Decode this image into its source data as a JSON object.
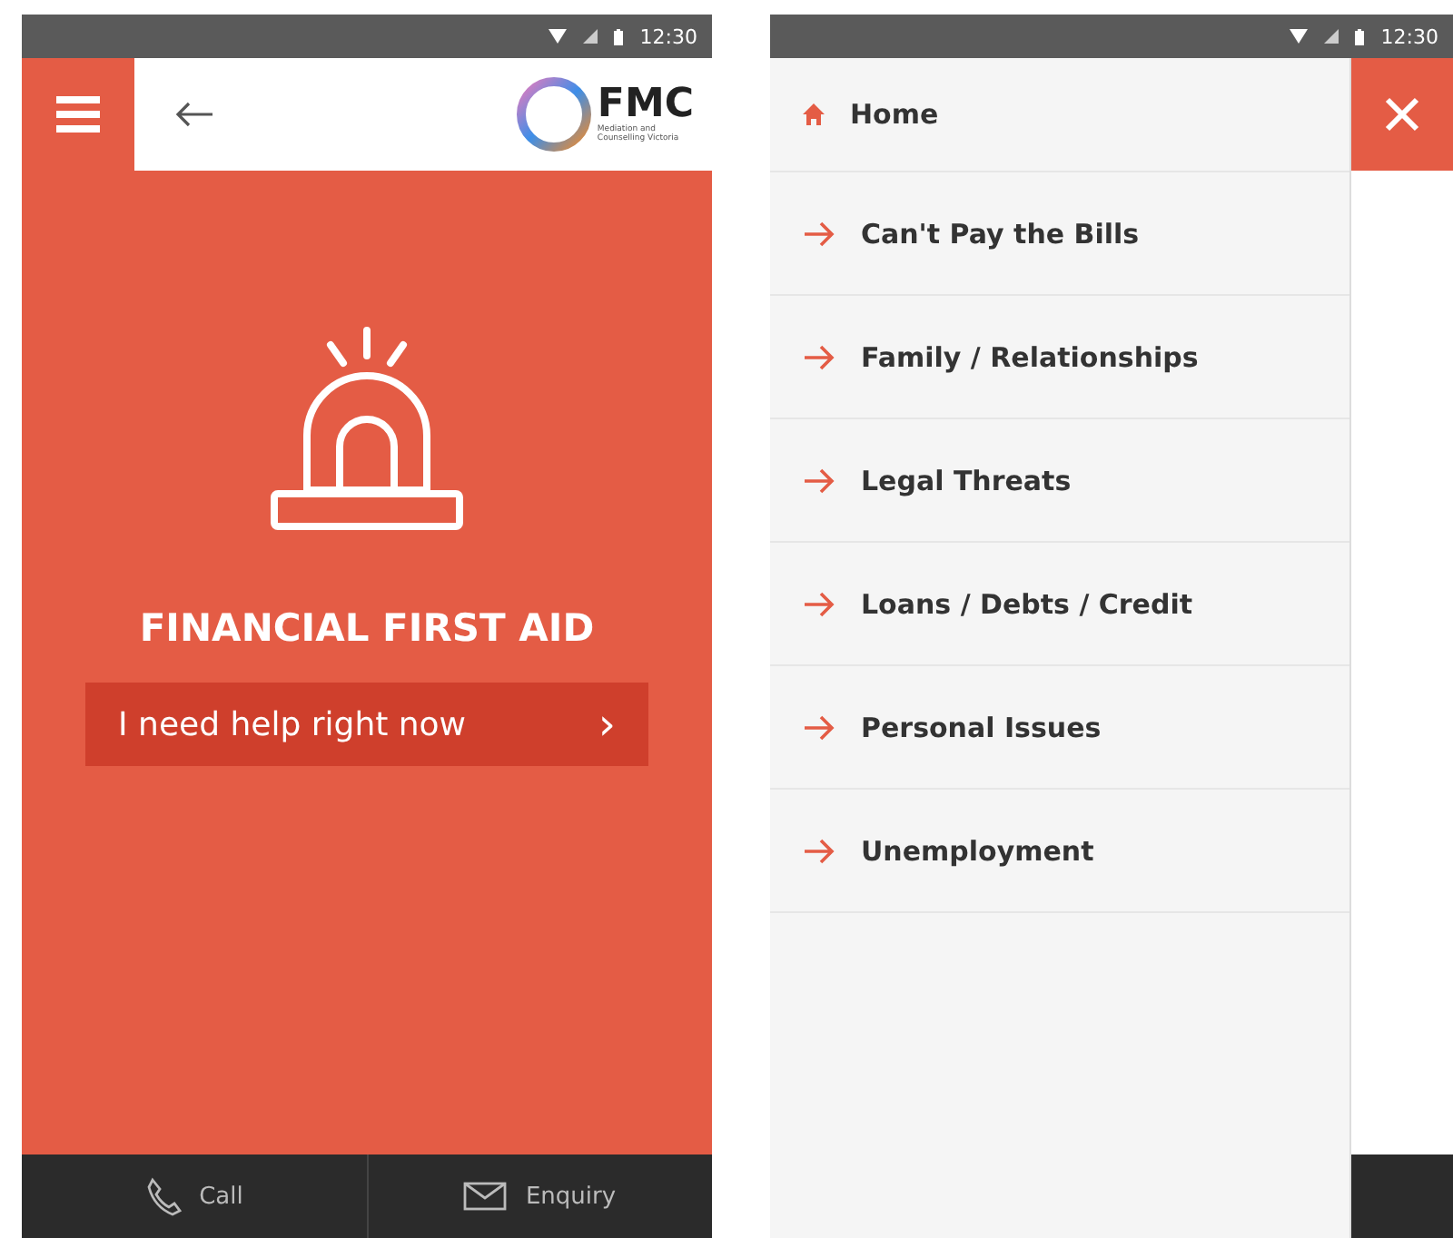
{
  "left_screen": {
    "status_bar": {
      "time": "12:30"
    },
    "header": {
      "logo": {
        "name": "FMC",
        "tagline_1": "Mediation and",
        "tagline_2": "Counselling Victoria"
      }
    },
    "hero": {
      "title": "FINANCIAL FIRST AID",
      "button": {
        "label": "I need help right now",
        "chevron": "›"
      }
    },
    "bottom_bar": [
      {
        "kind": "call",
        "label": "Call"
      },
      {
        "kind": "mail",
        "label": "Enquiry"
      }
    ]
  },
  "right_screen": {
    "status_bar": {
      "time": "12:30"
    },
    "menu": [
      {
        "kind": "home",
        "label": "Home"
      },
      {
        "kind": "link",
        "label": "Can't Pay the Bills"
      },
      {
        "kind": "link",
        "label": "Family / Relationships"
      },
      {
        "kind": "link",
        "label": "Legal Threats"
      },
      {
        "kind": "link",
        "label": "Loans / Debts / Credit"
      },
      {
        "kind": "link",
        "label": "Personal Issues"
      },
      {
        "kind": "link",
        "label": "Unemployment"
      }
    ]
  }
}
